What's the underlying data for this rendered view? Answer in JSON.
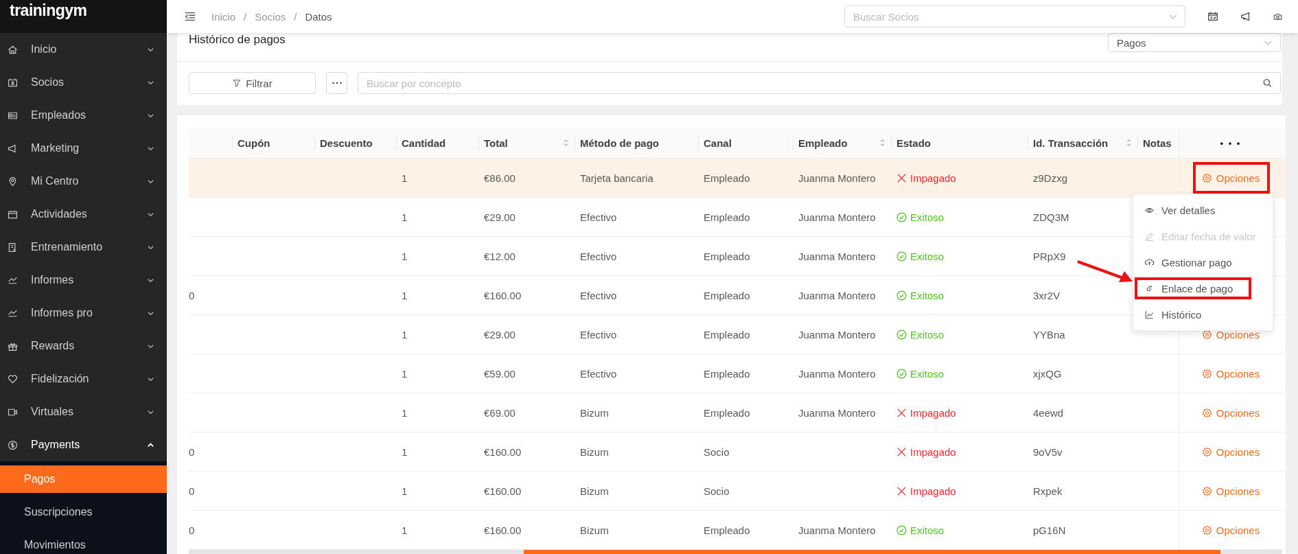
{
  "logo": "trainingym",
  "sidebar": {
    "items": [
      {
        "label": "Inicio",
        "expanded": false
      },
      {
        "label": "Socios",
        "expanded": false
      },
      {
        "label": "Empleados",
        "expanded": false
      },
      {
        "label": "Marketing",
        "expanded": false
      },
      {
        "label": "Mi Centro",
        "expanded": false
      },
      {
        "label": "Actividades",
        "expanded": false
      },
      {
        "label": "Entrenamiento",
        "expanded": false
      },
      {
        "label": "Informes",
        "expanded": false
      },
      {
        "label": "Informes pro",
        "expanded": false
      },
      {
        "label": "Rewards",
        "expanded": false
      },
      {
        "label": "Fidelización",
        "expanded": false
      },
      {
        "label": "Virtuales",
        "expanded": false
      },
      {
        "label": "Payments",
        "expanded": true,
        "children": [
          {
            "label": "Pagos",
            "selected": true
          },
          {
            "label": "Suscripciones",
            "selected": false
          },
          {
            "label": "Movimientos",
            "selected": false
          }
        ]
      }
    ]
  },
  "breadcrumb": [
    "Inicio",
    "/",
    "Socios",
    "/",
    "Datos"
  ],
  "header_search": {
    "placeholder": "Buscar Socios"
  },
  "panel": {
    "title": "Histórico de pagos",
    "view_select": "Pagos",
    "filter_button": "Filtrar",
    "search": {
      "placeholder": "Buscar por concepto"
    }
  },
  "table": {
    "columns": [
      {
        "label": "Cupón",
        "sortable": false
      },
      {
        "label": "Descuento",
        "sortable": false
      },
      {
        "label": "Cantidad",
        "sortable": false
      },
      {
        "label": "Total",
        "sortable": true
      },
      {
        "label": "Método de pago",
        "sortable": false
      },
      {
        "label": "Canal",
        "sortable": false
      },
      {
        "label": "Empleado",
        "sortable": true
      },
      {
        "label": "Estado",
        "sortable": false
      },
      {
        "label": "Id. Transacción",
        "sortable": true
      },
      {
        "label": "Notas",
        "sortable": false
      }
    ],
    "actions_header": "• • •",
    "rows": [
      {
        "column_1": null,
        "cantidad": "1",
        "total": "€86.00",
        "metodo": "Tarjeta bancaria",
        "canal": "Empleado",
        "empleado": "Juanma Montero",
        "estado": "Impagado",
        "kind": "unpaid",
        "id": "z9Dzxg",
        "action": "Opciones",
        "highlighted": true,
        "annotated": true
      },
      {
        "column_1": null,
        "cantidad": "1",
        "total": "€29.00",
        "metodo": "Efectivo",
        "canal": "Empleado",
        "empleado": "Juanma Montero",
        "estado": "Exitoso",
        "kind": "success",
        "id": "ZDQ3M",
        "action": null,
        "highlighted": false,
        "annotated": false
      },
      {
        "column_1": null,
        "cantidad": "1",
        "total": "€12.00",
        "metodo": "Efectivo",
        "canal": "Empleado",
        "empleado": "Juanma Montero",
        "estado": "Exitoso",
        "kind": "success",
        "id": "PRpX9",
        "action": null,
        "highlighted": false,
        "annotated": false
      },
      {
        "column_1": "0",
        "cantidad": "1",
        "total": "€160.00",
        "metodo": "Efectivo",
        "canal": "Empleado",
        "empleado": "Juanma Montero",
        "estado": "Exitoso",
        "kind": "success",
        "id": "3xr2V",
        "action": null,
        "highlighted": false,
        "annotated": false
      },
      {
        "column_1": null,
        "cantidad": "1",
        "total": "€29.00",
        "metodo": "Efectivo",
        "canal": "Empleado",
        "empleado": "Juanma Montero",
        "estado": "Exitoso",
        "kind": "success",
        "id": "YYBna",
        "action": "Opciones",
        "highlighted": false,
        "annotated": false
      },
      {
        "column_1": null,
        "cantidad": "1",
        "total": "€59.00",
        "metodo": "Efectivo",
        "canal": "Empleado",
        "empleado": "Juanma Montero",
        "estado": "Exitoso",
        "kind": "success",
        "id": "xjxQG",
        "action": "Opciones",
        "highlighted": false,
        "annotated": false
      },
      {
        "column_1": null,
        "cantidad": "1",
        "total": "€69.00",
        "metodo": "Bizum",
        "canal": "Empleado",
        "empleado": "Juanma Montero",
        "estado": "Impagado",
        "kind": "unpaid",
        "id": "4eewd",
        "action": "Opciones",
        "highlighted": false,
        "annotated": false
      },
      {
        "column_1": "0",
        "cantidad": "1",
        "total": "€160.00",
        "metodo": "Bizum",
        "canal": "Socio",
        "empleado": null,
        "estado": "Impagado",
        "kind": "unpaid",
        "id": "9oV5v",
        "action": "Opciones",
        "highlighted": false,
        "annotated": false
      },
      {
        "column_1": "0",
        "cantidad": "1",
        "total": "€160.00",
        "metodo": "Bizum",
        "canal": "Socio",
        "empleado": null,
        "estado": "Impagado",
        "kind": "unpaid",
        "id": "Rxpek",
        "action": "Opciones",
        "highlighted": false,
        "annotated": false
      },
      {
        "column_1": "0",
        "cantidad": "1",
        "total": "€160.00",
        "metodo": "Bizum",
        "canal": "Empleado",
        "empleado": "Juanma Montero",
        "estado": "Exitoso",
        "kind": "success",
        "id": "pG16N",
        "action": "Opciones",
        "highlighted": false,
        "annotated": false
      }
    ]
  },
  "options_menu": {
    "arrow": true,
    "items": [
      {
        "label": "Ver detalles",
        "kind": "view",
        "disabled": false,
        "annotated": false
      },
      {
        "label": "Editar fecha de valor",
        "kind": "edit",
        "disabled": true,
        "annotated": false
      },
      {
        "label": "Gestionar pago",
        "kind": "manage",
        "disabled": false,
        "annotated": false
      },
      {
        "label": "Enlace de pago",
        "kind": "link",
        "disabled": false,
        "annotated": true
      },
      {
        "label": "Histórico",
        "kind": "history",
        "disabled": false,
        "annotated": false
      }
    ]
  }
}
